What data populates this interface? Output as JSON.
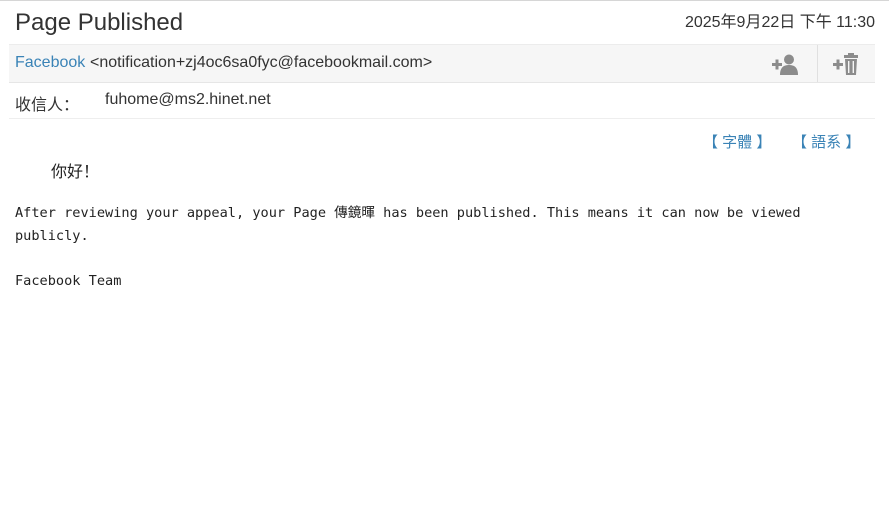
{
  "email": {
    "subject": "Page Published",
    "date": "2025年9月22日 下午 11:30",
    "from": {
      "name": "Facebook",
      "address": "<notification+zj4oc6sa0fyc@facebookmail.com>"
    },
    "to": {
      "label": "收信人：",
      "address": "fuhome@ms2.hinet.net"
    },
    "tools": {
      "font": "【 字體 】",
      "language": "【 語系 】"
    },
    "icons": {
      "add_contact": "add-contact-icon",
      "block": "block-sender-icon"
    },
    "body": {
      "greeting": "你好！",
      "paragraph": "After reviewing your appeal, your Page 傳鏡暉 has been published. This means it can now be viewed publicly.",
      "signature": "Facebook Team"
    }
  },
  "colors": {
    "link": "#3a83b6",
    "header_bg": "#f6f6f6",
    "icon": "#8c8c8c"
  }
}
